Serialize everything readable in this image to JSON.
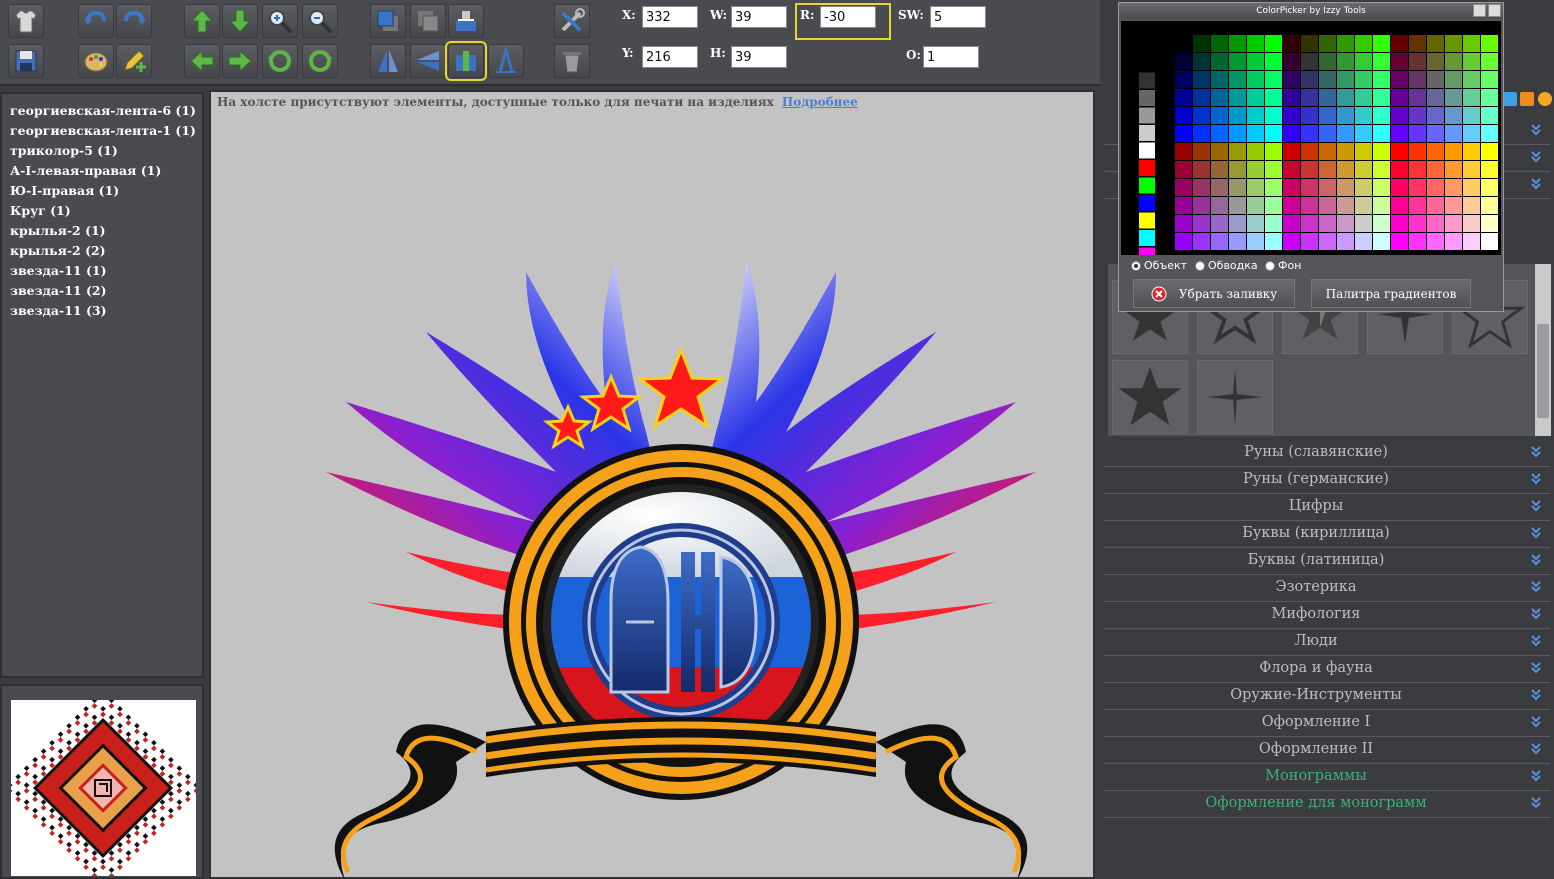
{
  "toolbar": {
    "fields": {
      "x": {
        "label": "X:",
        "value": "332"
      },
      "y": {
        "label": "Y:",
        "value": "216"
      },
      "w": {
        "label": "W:",
        "value": "39"
      },
      "h": {
        "label": "H:",
        "value": "39"
      },
      "r": {
        "label": "R:",
        "value": "-30"
      },
      "sw": {
        "label": "SW:",
        "value": "5"
      },
      "o": {
        "label": "O:",
        "value": "1"
      }
    },
    "icons": [
      "tshirt-icon",
      "undo-icon",
      "redo-icon",
      "move-up-icon",
      "move-down-icon",
      "zoom-in-icon",
      "zoom-out-icon",
      "bring-front-icon",
      "send-back-icon",
      "align-icon",
      "tools-icon",
      "save-icon",
      "palette-icon",
      "edit-icon",
      "move-left-icon",
      "move-right-icon",
      "rotate-ccw-icon",
      "rotate-cw-icon",
      "flip-vertical-icon",
      "flip-horizontal-icon",
      "center-icon",
      "skew-icon",
      "delete-icon"
    ]
  },
  "layers": [
    "георгиевская-лента-6 (1)",
    "георгиевская-лента-1 (1)",
    "триколор-5 (1)",
    "А-I-левая-правая (1)",
    "Ю-I-правая (1)",
    "Круг (1)",
    "крылья-2 (1)",
    "крылья-2 (2)",
    "звезда-11 (1)",
    "звезда-11 (2)",
    "звезда-11 (3)"
  ],
  "canvas": {
    "notice": "На холсте присутствуют элементы, доступные только для печати на изделиях",
    "notice_link": "Подробнее",
    "monogram": "АЮ"
  },
  "color_picker": {
    "title": "ColorPicker by Izzy Tools",
    "radios": [
      {
        "label": "Объект",
        "checked": true
      },
      {
        "label": "Обводка",
        "checked": false
      },
      {
        "label": "Фон",
        "checked": false
      }
    ],
    "remove_fill": "Убрать заливку",
    "gradient_palette": "Палитра градиентов"
  },
  "categories": [
    {
      "label": "Руны (славянские)",
      "green": false
    },
    {
      "label": "Руны (германские)",
      "green": false
    },
    {
      "label": "Цифры",
      "green": false
    },
    {
      "label": "Буквы (кириллица)",
      "green": false
    },
    {
      "label": "Буквы (латиница)",
      "green": false
    },
    {
      "label": "Эзотерика",
      "green": false
    },
    {
      "label": "Мифология",
      "green": false
    },
    {
      "label": "Люди",
      "green": false
    },
    {
      "label": "Флора и фауна",
      "green": false
    },
    {
      "label": "Оружие-Инструменты",
      "green": false
    },
    {
      "label": "Оформление I",
      "green": false
    },
    {
      "label": "Оформление II",
      "green": false
    },
    {
      "label": "Монограммы",
      "green": true
    },
    {
      "label": "Оформление для монограмм",
      "green": true
    }
  ],
  "colors": {
    "accent_highlight": "#e8d62a",
    "category_text": "#bdbec2",
    "category_green": "#3fae7d",
    "link": "#4a7fd0"
  }
}
